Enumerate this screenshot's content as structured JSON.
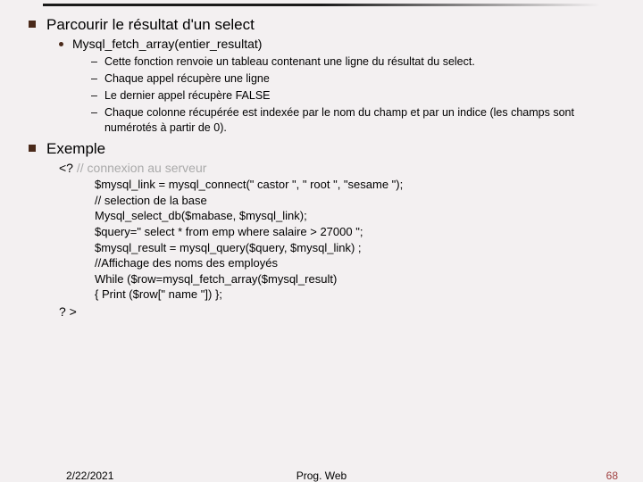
{
  "section1": {
    "heading": "Parcourir le résultat d'un select",
    "sub": "Mysql_fetch_array(entier_resultat)",
    "items": [
      "Cette fonction renvoie un tableau contenant une ligne du résultat du select.",
      "Chaque appel récupère une ligne",
      "Le dernier appel récupère FALSE",
      "Chaque colonne récupérée est indexée par le nom du champ et par un indice (les champs sont numérotés à partir de 0)."
    ]
  },
  "section2": {
    "heading": "Exemple",
    "open_tag": "<?",
    "open_comment": " // connexion au serveur",
    "code_lines": [
      "$mysql_link = mysql_connect(\" castor \", \" root \", \"sesame \");",
      "// selection de la base",
      "Mysql_select_db($mabase, $mysql_link);",
      "$query=\" select * from emp where salaire > 27000 \";",
      "$mysql_result = mysql_query($query, $mysql_link) ;",
      "//Affichage des noms des employés",
      "While ($row=mysql_fetch_array($mysql_result)",
      "{       Print ($row[\" name \"])  };"
    ],
    "close_tag": "? >"
  },
  "footer": {
    "date": "2/22/2021",
    "title": "Prog. Web",
    "page": "68"
  }
}
